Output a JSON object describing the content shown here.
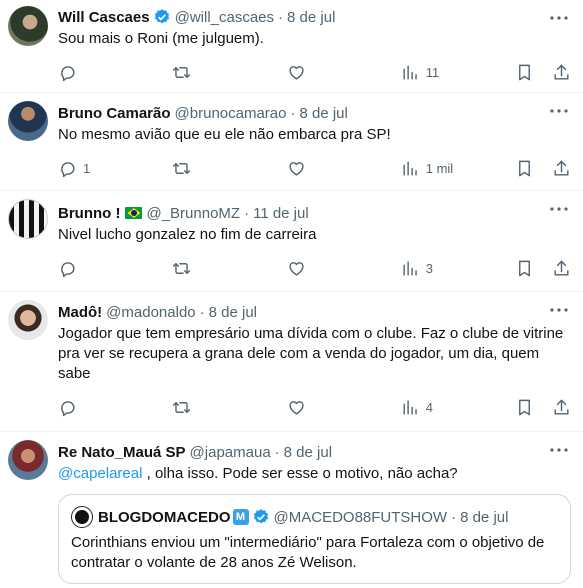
{
  "tweets": [
    {
      "name": "Will Cascaes",
      "handle": "@will_cascaes",
      "date": "8 de jul",
      "text": "Sou mais o Roni (me julguem).",
      "replies": "",
      "views": "11"
    },
    {
      "name": "Bruno Camarão",
      "handle": "@brunocamarao",
      "date": "8 de jul",
      "text": "No mesmo avião que eu ele não embarca pra SP!",
      "replies": "1",
      "views": "1 mil"
    },
    {
      "name": "Brunno !",
      "handle": "@_BrunnoMZ",
      "date": "11 de jul",
      "text": "Nivel lucho gonzalez no fim de carreira",
      "replies": "",
      "views": "3"
    },
    {
      "name": "Madô!",
      "handle": "@madonaldo",
      "date": "8 de jul",
      "text": "Jogador que tem empresário uma dívida com o clube. Faz o clube de vitrine pra ver se recupera a grana dele com a venda do jogador, um dia, quem sabe",
      "replies": "",
      "views": "4"
    },
    {
      "name": "Re Nato_Mauá SP",
      "handle": "@japamaua",
      "date": "8 de jul",
      "mention": "@capelareal",
      "text": " , olha isso. Pode ser esse o motivo, não acha?"
    }
  ],
  "quote": {
    "name": "BLOGDOMACEDO",
    "badge": "M",
    "handle": "@MACEDO88FUTSHOW",
    "date": "8 de jul",
    "text": "Corinthians enviou um \"intermediário\" para Fortaleza com o objetivo de contratar o volante de 28 anos Zé Welison."
  },
  "separator": "·",
  "icons": [
    "reply-icon",
    "retweet-icon",
    "like-icon",
    "views-icon",
    "bookmark-icon",
    "share-icon",
    "verified-icon",
    "more-icon"
  ],
  "colors": {
    "accent": "#1d9bf0",
    "muted": "#536471",
    "text": "#0f1419",
    "border": "#eff3f4"
  }
}
